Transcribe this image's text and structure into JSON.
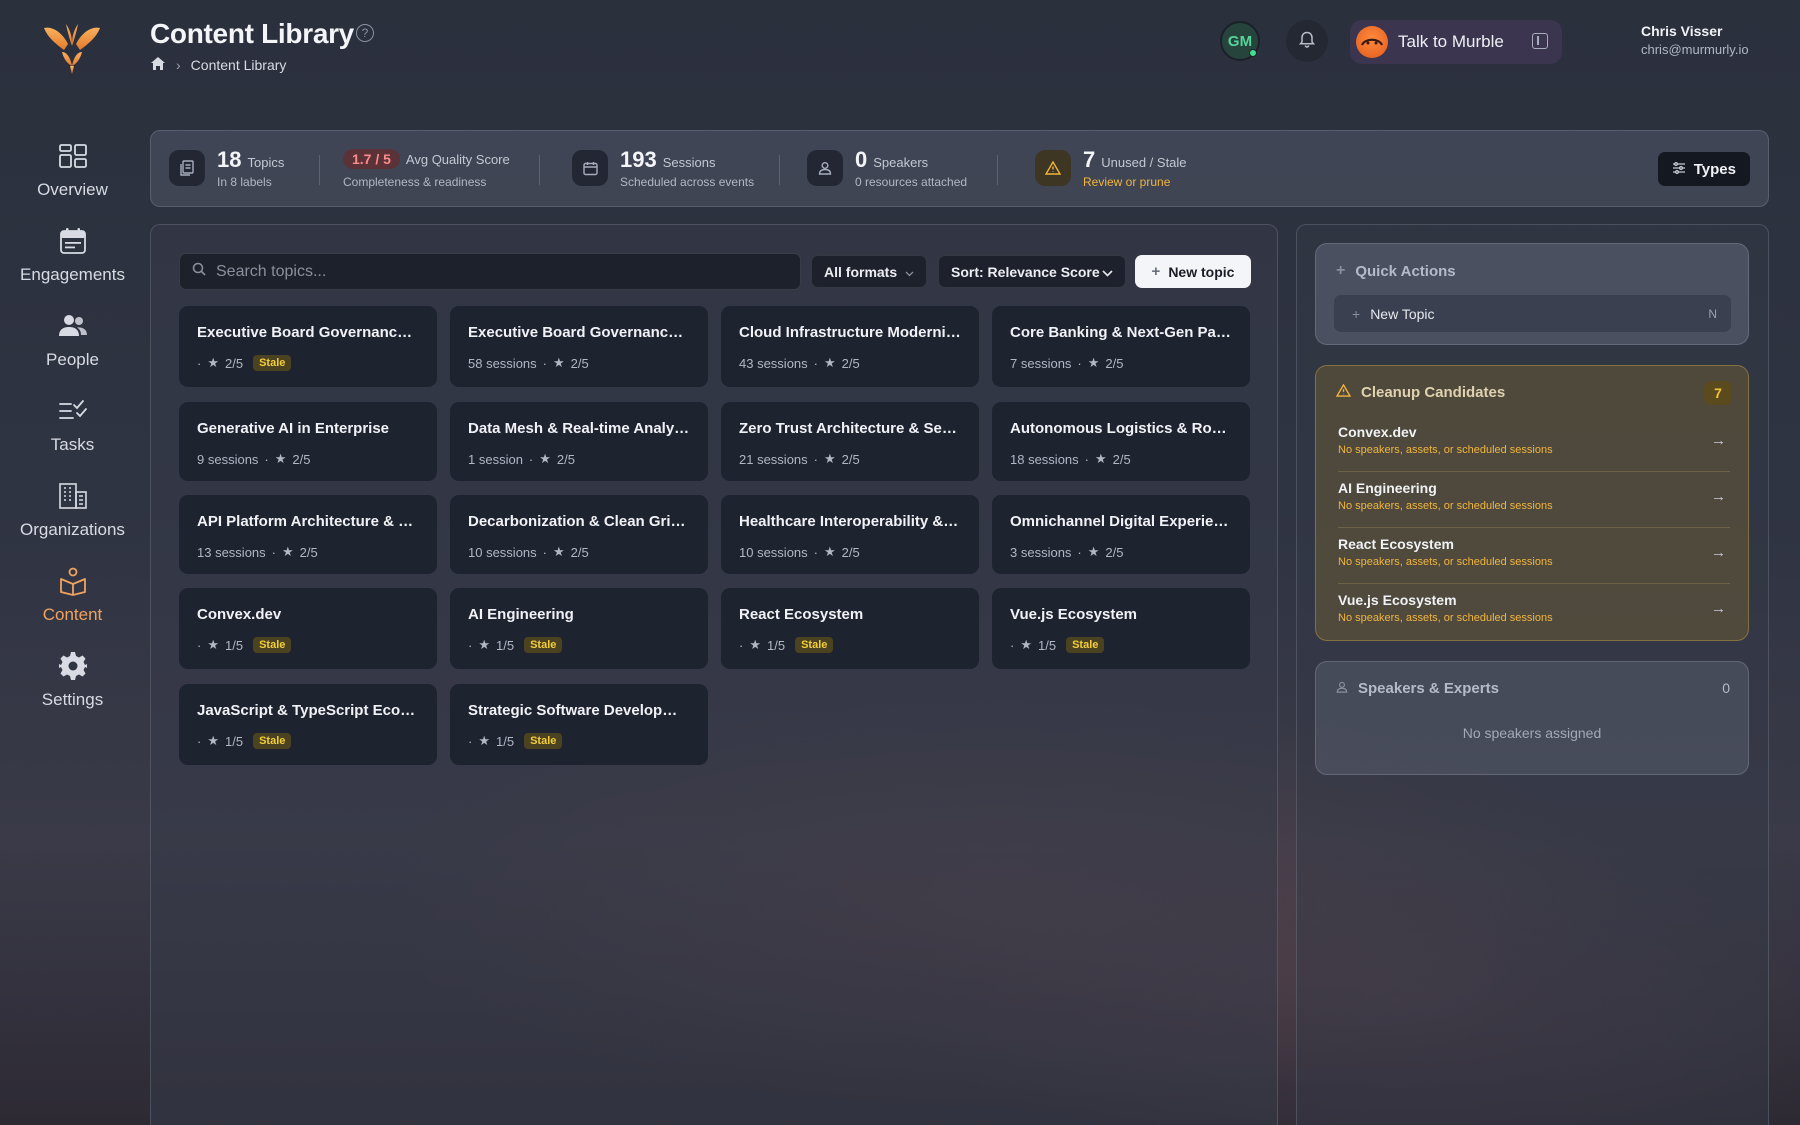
{
  "colors": {
    "accent": "#f0a25e",
    "stale": "#f4cd3a",
    "warning": "#f2b43e",
    "online": "#3ee08f"
  },
  "nav": [
    {
      "label": "Overview",
      "icon": "grid-icon"
    },
    {
      "label": "Engagements",
      "icon": "calendar-icon"
    },
    {
      "label": "People",
      "icon": "people-icon"
    },
    {
      "label": "Tasks",
      "icon": "tasks-icon"
    },
    {
      "label": "Organizations",
      "icon": "building-icon"
    },
    {
      "label": "Content",
      "icon": "content-icon",
      "active": true
    },
    {
      "label": "Settings",
      "icon": "gear-icon"
    }
  ],
  "header": {
    "title": "Content Library",
    "help": "?",
    "breadcrumb": {
      "current": "Content Library"
    },
    "avatar_initials": "GM",
    "murble_label": "Talk to Murble",
    "user": {
      "name": "Chris Visser",
      "email": "chris@murmurly.io"
    }
  },
  "stats": {
    "topics": {
      "value": "18",
      "unit": "Topics",
      "sub": "In 8 labels"
    },
    "quality": {
      "value": "1.7 / 5",
      "unit": "Avg Quality Score",
      "sub": "Completeness & readiness"
    },
    "sessions": {
      "value": "193",
      "unit": "Sessions",
      "sub": "Scheduled across events"
    },
    "speakers": {
      "value": "0",
      "unit": "Speakers",
      "sub": "0 resources attached"
    },
    "unused": {
      "value": "7",
      "unit": "Unused / Stale",
      "sub": "Review or prune"
    },
    "types_label": "Types"
  },
  "toolbar": {
    "search_placeholder": "Search topics...",
    "format_label": "All formats",
    "sort_label": "Sort: Relevance Score",
    "new_topic_label": "New topic"
  },
  "topics": [
    {
      "title": "Executive Board Governance &...",
      "sessions": "",
      "rating": "2/5",
      "stale": "Stale"
    },
    {
      "title": "Executive Board Governance &...",
      "sessions": "58 sessions",
      "rating": "2/5",
      "stale": ""
    },
    {
      "title": "Cloud Infrastructure Moderniz...",
      "sessions": "43 sessions",
      "rating": "2/5",
      "stale": ""
    },
    {
      "title": "Core Banking & Next-Gen Pay...",
      "sessions": "7 sessions",
      "rating": "2/5",
      "stale": ""
    },
    {
      "title": "Generative AI in Enterprise",
      "sessions": "9 sessions",
      "rating": "2/5",
      "stale": ""
    },
    {
      "title": "Data Mesh & Real-time Analytics",
      "sessions": "1 session",
      "rating": "2/5",
      "stale": ""
    },
    {
      "title": "Zero Trust Architecture & Secu...",
      "sessions": "21 sessions",
      "rating": "2/5",
      "stale": ""
    },
    {
      "title": "Autonomous Logistics & Robot...",
      "sessions": "18 sessions",
      "rating": "2/5",
      "stale": ""
    },
    {
      "title": "API Platform Architecture & De...",
      "sessions": "13 sessions",
      "rating": "2/5",
      "stale": ""
    },
    {
      "title": "Decarbonization & Clean Grid ...",
      "sessions": "10 sessions",
      "rating": "2/5",
      "stale": ""
    },
    {
      "title": "Healthcare Interoperability & C...",
      "sessions": "10 sessions",
      "rating": "2/5",
      "stale": ""
    },
    {
      "title": "Omnichannel Digital Experience",
      "sessions": "3 sessions",
      "rating": "2/5",
      "stale": ""
    },
    {
      "title": "Convex.dev",
      "sessions": "",
      "rating": "1/5",
      "stale": "Stale"
    },
    {
      "title": "AI Engineering",
      "sessions": "",
      "rating": "1/5",
      "stale": "Stale"
    },
    {
      "title": "React Ecosystem",
      "sessions": "",
      "rating": "1/5",
      "stale": "Stale"
    },
    {
      "title": "Vue.js Ecosystem",
      "sessions": "",
      "rating": "1/5",
      "stale": "Stale"
    },
    {
      "title": "JavaScript & TypeScript Ecosy...",
      "sessions": "",
      "rating": "1/5",
      "stale": "Stale"
    },
    {
      "title": "Strategic Software Development",
      "sessions": "",
      "rating": "1/5",
      "stale": "Stale"
    }
  ],
  "quick_actions": {
    "title": "Quick Actions",
    "items": [
      {
        "label": "New Topic",
        "shortcut": "N"
      }
    ]
  },
  "cleanup": {
    "title": "Cleanup Candidates",
    "count": "7",
    "items": [
      {
        "name": "Convex.dev",
        "desc": "No speakers, assets, or scheduled sessions"
      },
      {
        "name": "AI Engineering",
        "desc": "No speakers, assets, or scheduled sessions"
      },
      {
        "name": "React Ecosystem",
        "desc": "No speakers, assets, or scheduled sessions"
      },
      {
        "name": "Vue.js Ecosystem",
        "desc": "No speakers, assets, or scheduled sessions"
      }
    ]
  },
  "speakers": {
    "title": "Speakers & Experts",
    "count": "0",
    "empty": "No speakers assigned"
  }
}
